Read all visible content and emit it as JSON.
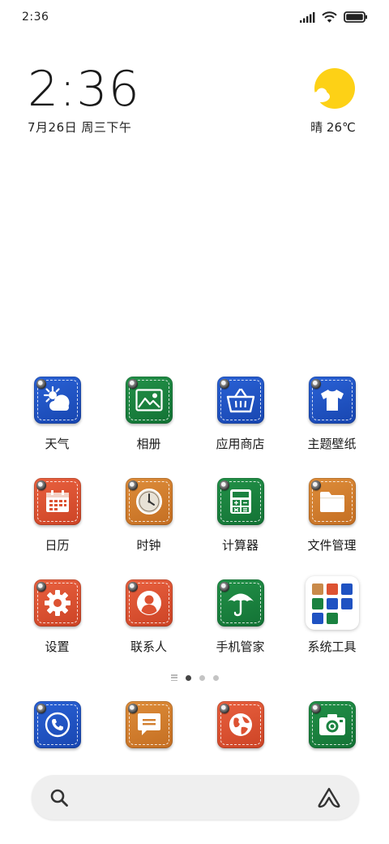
{
  "status_bar": {
    "time": "2:36",
    "icons": [
      "signal-icon",
      "wifi-icon",
      "battery-icon"
    ]
  },
  "clock_widget": {
    "time": "2:36",
    "date": "7月26日 周三下午"
  },
  "weather_widget": {
    "icon": "sunny-cloud-icon",
    "text": "晴 26℃"
  },
  "apps": [
    {
      "label": "天气",
      "icon": "weather-icon",
      "color": "blue"
    },
    {
      "label": "相册",
      "icon": "gallery-icon",
      "color": "green"
    },
    {
      "label": "应用商店",
      "icon": "store-basket-icon",
      "color": "blue"
    },
    {
      "label": "主题壁纸",
      "icon": "theme-shirt-icon",
      "color": "blue"
    },
    {
      "label": "日历",
      "icon": "calendar-icon",
      "color": "red"
    },
    {
      "label": "时钟",
      "icon": "clock-icon",
      "color": "orange"
    },
    {
      "label": "计算器",
      "icon": "calculator-icon",
      "color": "green"
    },
    {
      "label": "文件管理",
      "icon": "folder-icon",
      "color": "orange"
    },
    {
      "label": "设置",
      "icon": "gear-icon",
      "color": "red"
    },
    {
      "label": "联系人",
      "icon": "contact-icon",
      "color": "red"
    },
    {
      "label": "手机管家",
      "icon": "security-umbrella-icon",
      "color": "green"
    },
    {
      "label": "系统工具",
      "icon": "folder-group-icon",
      "color": "white"
    }
  ],
  "page_indicator": {
    "pages": 3,
    "active": 1
  },
  "dock": [
    {
      "name": "phone",
      "icon": "phone-icon",
      "color": "blue"
    },
    {
      "name": "messages",
      "icon": "message-icon",
      "color": "orange"
    },
    {
      "name": "browser",
      "icon": "globe-icon",
      "color": "red"
    },
    {
      "name": "camera",
      "icon": "camera-icon",
      "color": "green"
    }
  ],
  "search_bar": {
    "left_icon": "search-icon",
    "right_icon": "assistant-icon"
  },
  "colors": {
    "blue": "#1f52c2",
    "green": "#1a8240",
    "orange": "#d27e2e",
    "red": "#dd5232",
    "sun": "#fdd116"
  }
}
